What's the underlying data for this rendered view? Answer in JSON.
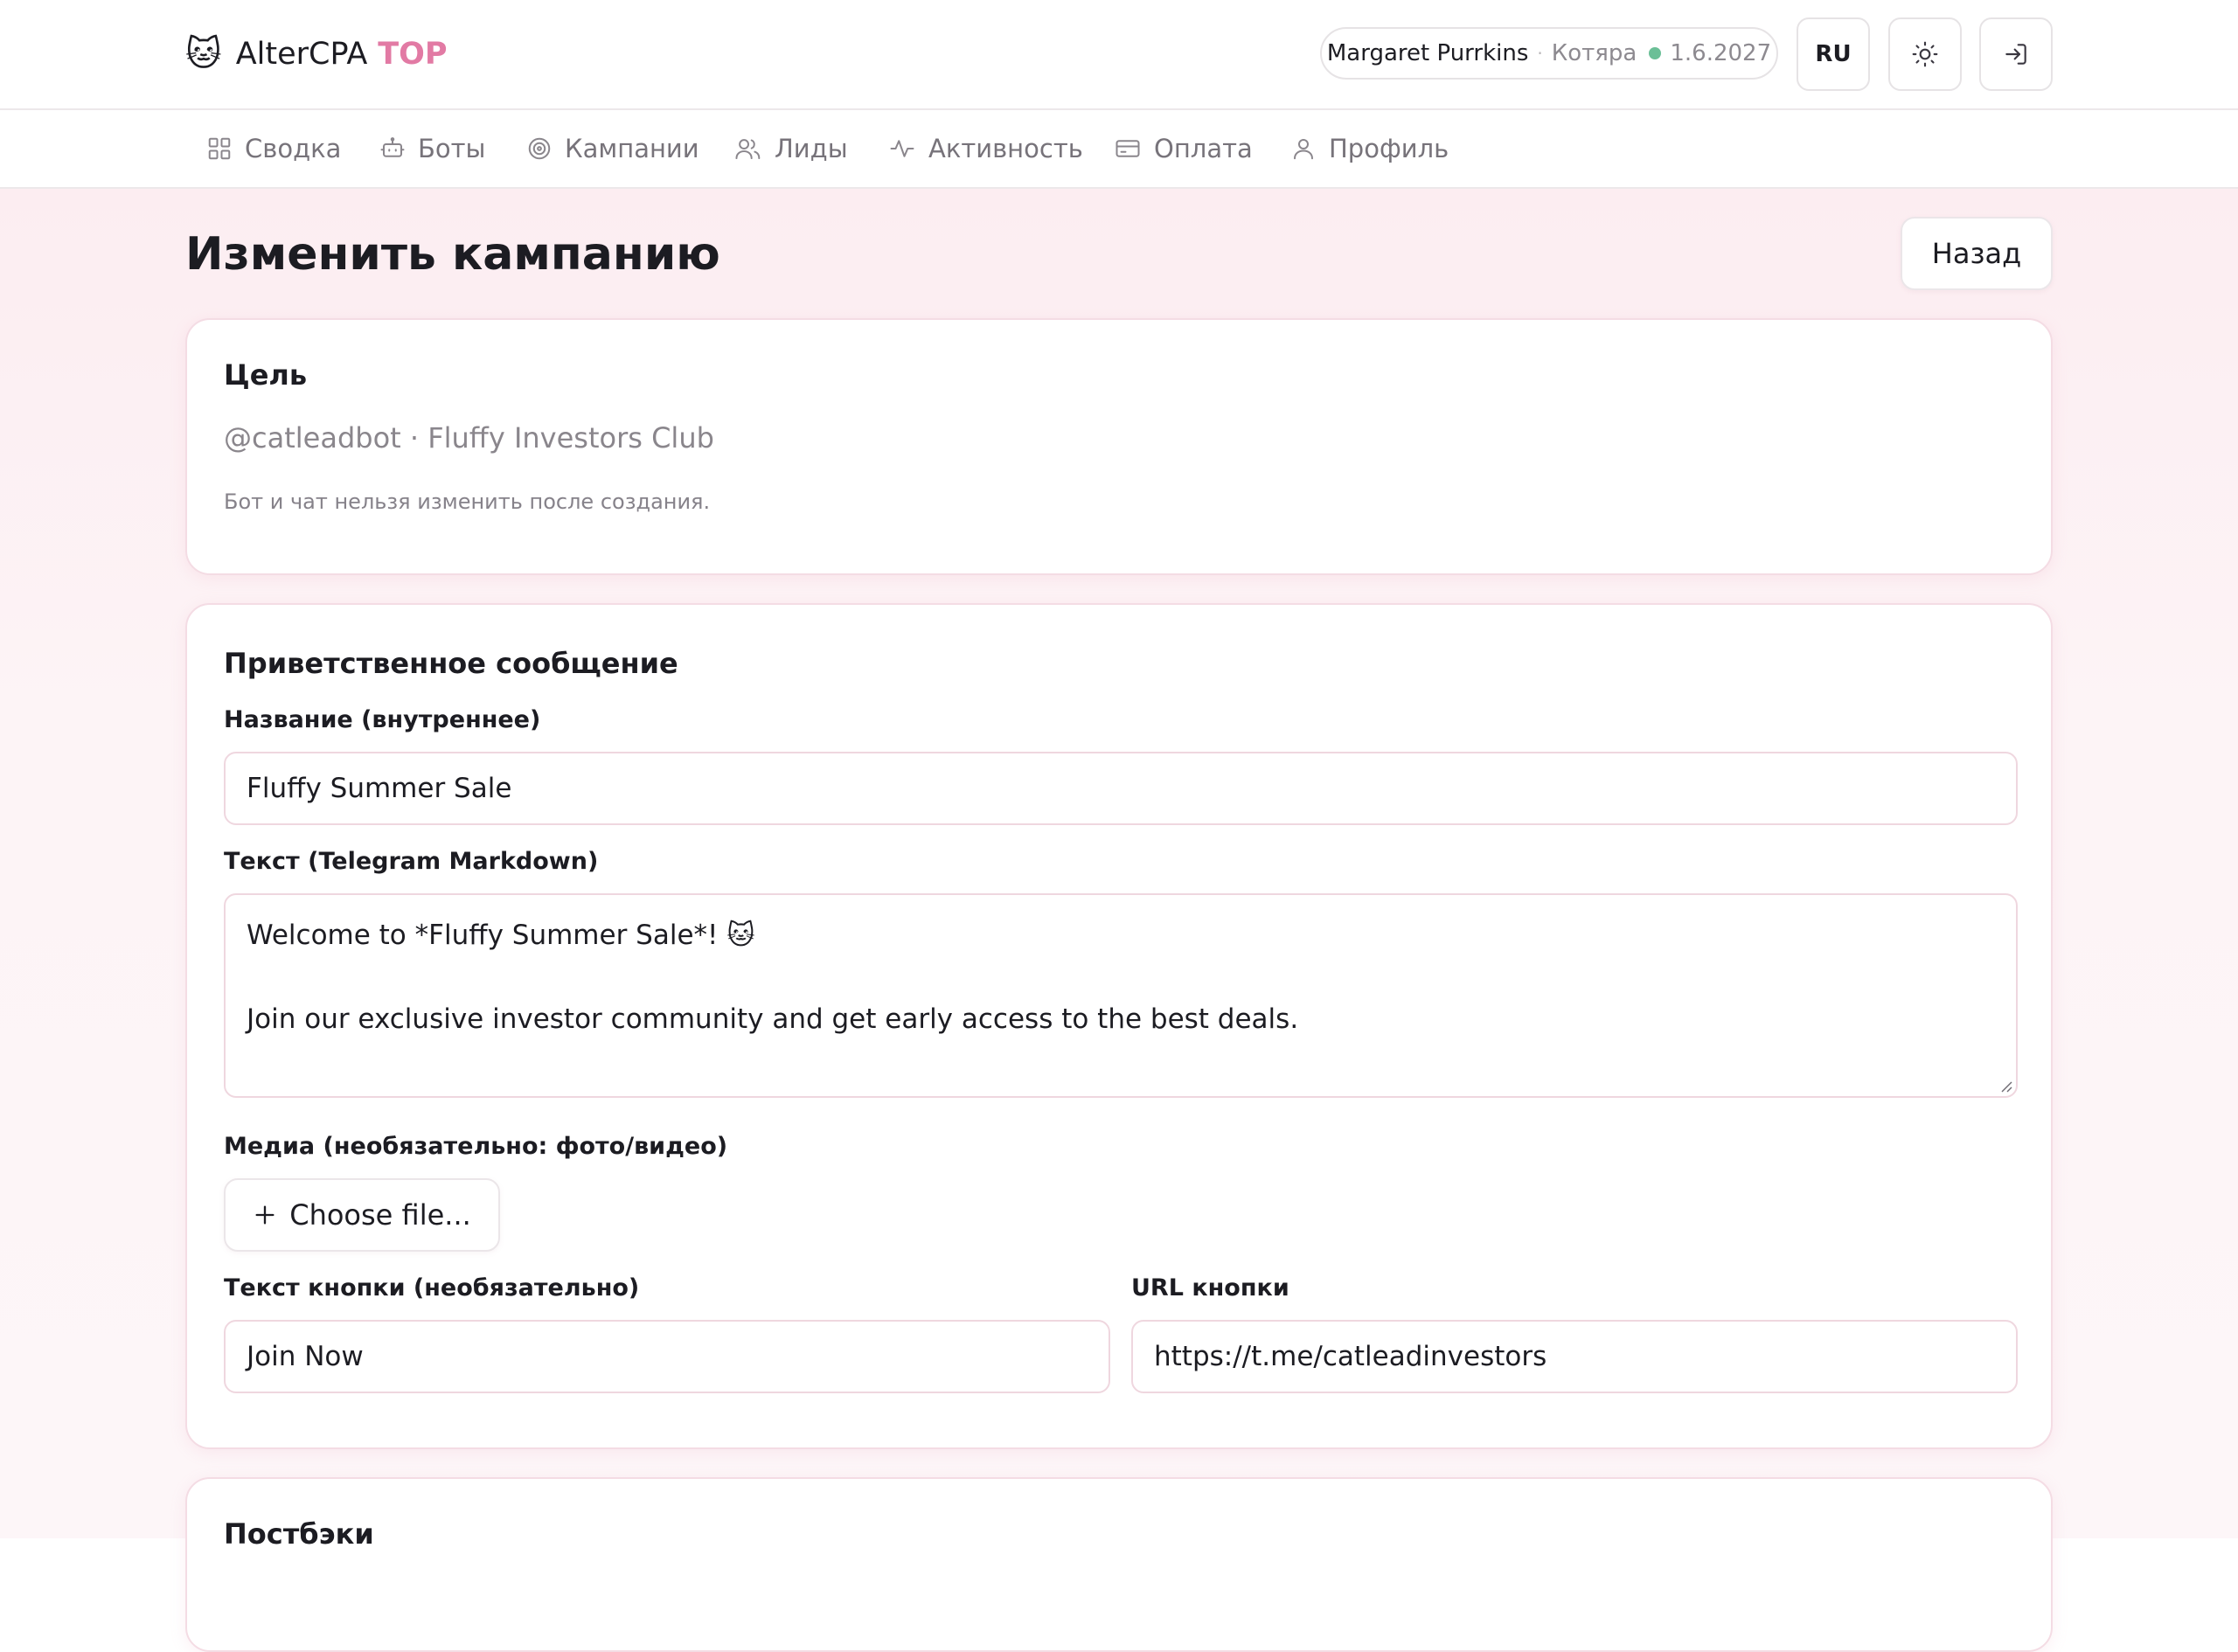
{
  "brand": {
    "logo": "🐱",
    "name": "AlterCPA",
    "accent": "TOP"
  },
  "user": {
    "name": "Margaret Purrkins",
    "separator": "·",
    "role": "Котяра",
    "date": "1.6.2027"
  },
  "header_buttons": {
    "language": "RU",
    "theme_icon": "sun-icon",
    "logout_icon": "logout-icon"
  },
  "nav": [
    {
      "label": "Сводка",
      "icon": "dashboard-grid-icon"
    },
    {
      "label": "Боты",
      "icon": "bot-icon"
    },
    {
      "label": "Кампании",
      "icon": "target-icon"
    },
    {
      "label": "Лиды",
      "icon": "users-icon"
    },
    {
      "label": "Активность",
      "icon": "activity-icon"
    },
    {
      "label": "Оплата",
      "icon": "credit-card-icon"
    },
    {
      "label": "Профиль",
      "icon": "user-icon"
    }
  ],
  "page": {
    "title": "Изменить кампанию",
    "back_label": "Назад"
  },
  "target_card": {
    "title": "Цель",
    "value": "@catleadbot · Fluffy Investors Club",
    "hint": "Бот и чат нельзя изменить после создания."
  },
  "welcome_card": {
    "title": "Приветственное сообщение",
    "name_label": "Название (внутреннее)",
    "name_value": "Fluffy Summer Sale",
    "text_label": "Текст (Telegram Markdown)",
    "text_line1": "Welcome to *Fluffy Summer Sale*! 🐱",
    "text_line2": "",
    "text_line3": "Join our exclusive investor community and get early access to the best deals.",
    "media_label": "Медиа (необязательно: фото/видео)",
    "choose_file": "Choose file...",
    "button_text_label": "Текст кнопки (необязательно)",
    "button_text_value": "Join Now",
    "button_url_label": "URL кнопки",
    "button_url_value": "https://t.me/catleadinvestors"
  },
  "postbacks_card": {
    "title": "Постбэки"
  },
  "colors": {
    "accent": "#e27aa4",
    "status": "#6bbf97",
    "card_border": "#f4dce4"
  }
}
